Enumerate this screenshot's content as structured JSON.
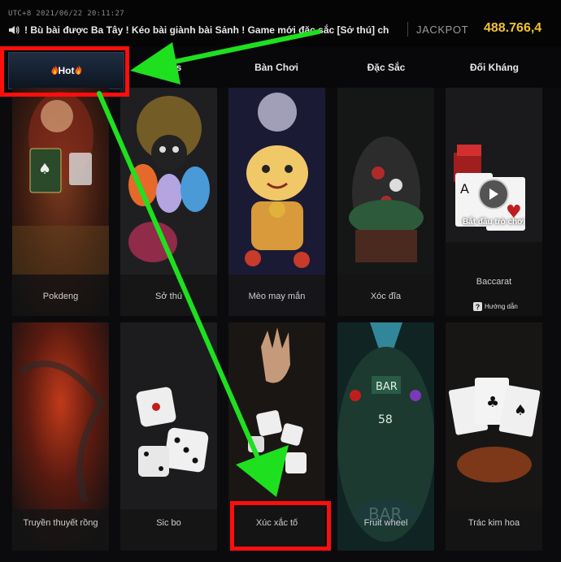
{
  "header": {
    "clock": "UTC+8 2021/06/22 20:11:27",
    "marquee": "! Bù bài được Ba Tây ! Kéo bài giành bài Sảnh !     Game mới đặc sắc [Sở thú] ch",
    "jackpot_label": "JACKPOT",
    "jackpot_value": "488.766,4"
  },
  "tabs": [
    {
      "label": "Hot"
    },
    {
      "label": "s"
    },
    {
      "label": "Bàn Chơi"
    },
    {
      "label": "Đặc Sắc"
    },
    {
      "label": "Đối Kháng"
    }
  ],
  "games_row1": [
    {
      "name": "Pokdeng"
    },
    {
      "name": "Sở thú"
    },
    {
      "name": "Mèo may mắn"
    },
    {
      "name": "Xóc đĩa"
    },
    {
      "name": "Baccarat",
      "start_label": "Bắt đầu trò chơi",
      "guide_label": "Hướng dẫn"
    }
  ],
  "games_row2": [
    {
      "name": "Truyền thuyết rồng"
    },
    {
      "name": "Sic bo"
    },
    {
      "name": "Xúc xắc tố"
    },
    {
      "name": "Fruit wheel"
    },
    {
      "name": "Trác kim hoa"
    }
  ],
  "annotation_colors": {
    "arrow": "#1fe01f",
    "highlight": "#ff0e0e"
  },
  "icons": [
    "speaker-icon",
    "fire-icon",
    "play-icon",
    "question-icon"
  ]
}
